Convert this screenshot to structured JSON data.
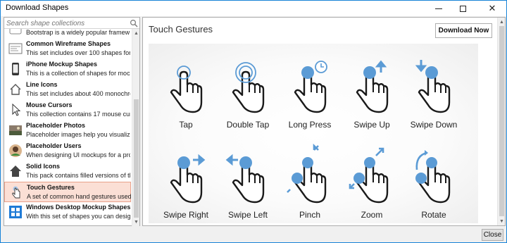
{
  "window": {
    "title": "Download Shapes"
  },
  "search": {
    "placeholder": "Search shape collections"
  },
  "collections": [
    {
      "title": "",
      "desc": "Bootstrap is a widely popular framew",
      "icon": "bootstrap-icon"
    },
    {
      "title": "Common Wireframe Shapes",
      "desc": "This set includes over 100 shapes for l",
      "icon": "wireframe-icon"
    },
    {
      "title": "iPhone Mockup Shapes",
      "desc": "This is a collection of shapes for mock",
      "icon": "iphone-icon"
    },
    {
      "title": "Line Icons",
      "desc": "This set includes about 400 monochro",
      "icon": "line-icons-icon"
    },
    {
      "title": "Mouse Cursors",
      "desc": "This collection contains 17 mouse cur",
      "icon": "mouse-cursor-icon"
    },
    {
      "title": "Placeholder Photos",
      "desc": "Placeholder images help you visualize",
      "icon": "photo-icon"
    },
    {
      "title": "Placeholder Users",
      "desc": "When designing UI mockups for a pro",
      "icon": "user-avatar-icon"
    },
    {
      "title": "Solid Icons",
      "desc": "This pack contains filled versions of the",
      "icon": "solid-icons-icon"
    },
    {
      "title": "Touch Gestures",
      "desc": "A set of common hand gestures used",
      "icon": "touch-gesture-icon"
    },
    {
      "title": "Windows Desktop Mockup Shapes",
      "desc": "With this set of shapes you can desig",
      "icon": "windows-icon"
    }
  ],
  "selected_index": 8,
  "detail": {
    "heading": "Touch Gestures",
    "download_label": "Download Now",
    "gestures": [
      {
        "label": "Tap",
        "icon": "tap-gesture-icon"
      },
      {
        "label": "Double Tap",
        "icon": "double-tap-gesture-icon"
      },
      {
        "label": "Long Press",
        "icon": "long-press-gesture-icon"
      },
      {
        "label": "Swipe Up",
        "icon": "swipe-up-gesture-icon"
      },
      {
        "label": "Swipe Down",
        "icon": "swipe-down-gesture-icon"
      },
      {
        "label": "Swipe Right",
        "icon": "swipe-right-gesture-icon"
      },
      {
        "label": "Swipe Left",
        "icon": "swipe-left-gesture-icon"
      },
      {
        "label": "Pinch",
        "icon": "pinch-gesture-icon"
      },
      {
        "label": "Zoom",
        "icon": "zoom-gesture-icon"
      },
      {
        "label": "Rotate",
        "icon": "rotate-gesture-icon"
      }
    ]
  },
  "footer": {
    "close_label": "Close"
  },
  "colors": {
    "accent": "#5b9bd5",
    "selection": "#fbdfd5",
    "window_border": "#1883d7"
  }
}
